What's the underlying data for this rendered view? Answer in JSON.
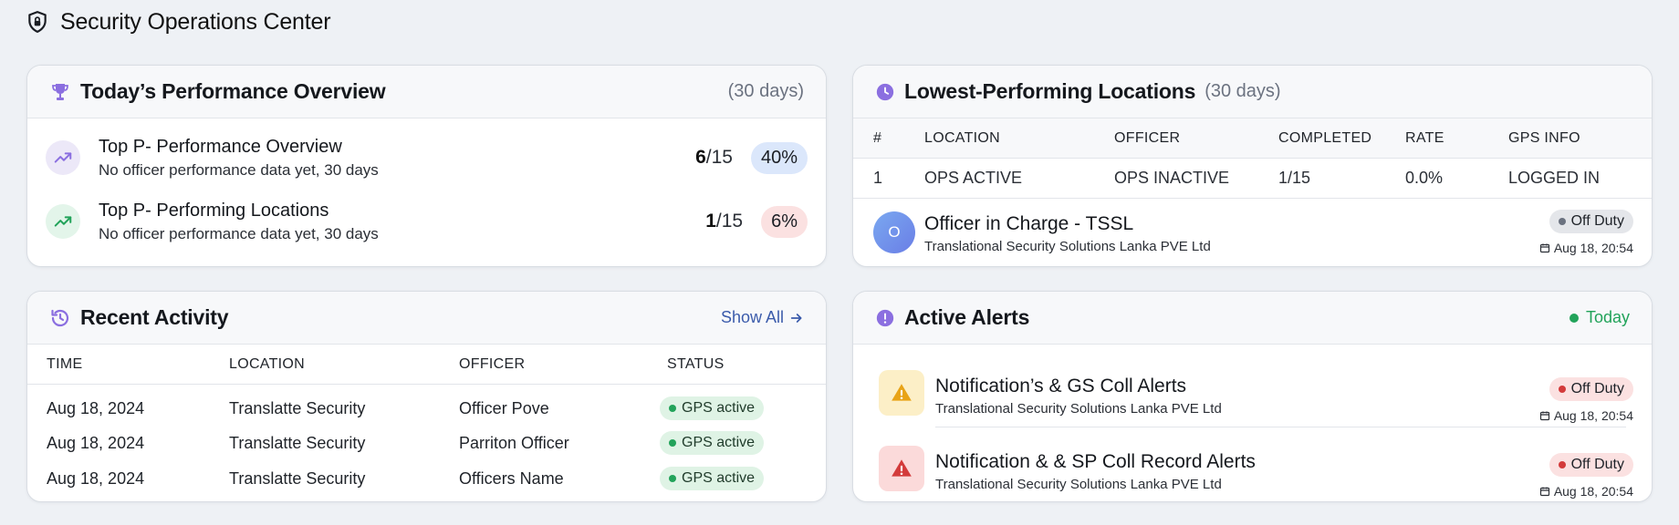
{
  "header": {
    "title": "Security Operations Center",
    "icon": "shield-lock-icon"
  },
  "performance": {
    "title": "Today’s Performance Overview",
    "period": "(30 days)",
    "rows": [
      {
        "title": "Top P- Performance Overview",
        "subtitle": "No officer performance data yet, 30 days",
        "count": "6",
        "total": "/15",
        "percent": "40%",
        "icon": "trend-up-icon",
        "pill_color": "#dbe7fb"
      },
      {
        "title": "Top P- Performing Locations",
        "subtitle": "No officer performance data yet, 30 days",
        "count": "1",
        "total": "/15",
        "percent": "6%",
        "icon": "trend-up-icon",
        "pill_color": "#fbe1e1"
      }
    ]
  },
  "lowest": {
    "title": "Lowest-Performing Locations",
    "period": "(30 days)",
    "columns": [
      "#",
      "LOCATION",
      "OFFICER",
      "COMPLETED",
      "RATE",
      "GPS INFO"
    ],
    "rows": [
      [
        "1",
        "OPS ACTIVE",
        "OPS INACTIVE",
        "1/15",
        "0.0%",
        "LOGGED IN"
      ]
    ],
    "officer": {
      "initial": "O",
      "name": "Officer in Charge - TSSL",
      "org": "Translational Security Solutions Lanka PVE Ltd",
      "status": "Off Duty",
      "time": "Aug 18, 20:54"
    }
  },
  "recent": {
    "title": "Recent Activity",
    "show_all": "Show All",
    "columns": [
      "TIME",
      "LOCATION",
      "OFFICER",
      "STATUS"
    ],
    "rows": [
      [
        "Aug 18, 2024",
        "Translatte Security",
        "Officer Pove",
        "GPS active"
      ],
      [
        "Aug 18, 2024",
        "Translatte Security",
        "Parriton Officer",
        "GPS active"
      ],
      [
        "Aug 18, 2024",
        "Translatte Security",
        "Officers Name",
        "GPS active"
      ]
    ]
  },
  "alerts": {
    "title": "Active Alerts",
    "today": "Today",
    "items": [
      {
        "title": "Notification’s & GS Coll Alerts",
        "org": "Translational Security Solutions Lanka PVE Ltd",
        "status": "Off Duty",
        "time": "Aug 18, 20:54",
        "icon": "warning-triangle-icon",
        "icon_color": "#e8a317"
      },
      {
        "title": "Notification & & SP Coll Record Alerts",
        "org": "Translational Security Solutions Lanka PVE Ltd",
        "status": "Off Duty",
        "time": "Aug 18, 20:54",
        "icon": "alert-triangle-icon",
        "icon_color": "#d33b3b"
      }
    ]
  },
  "colors": {
    "accent": "#8b6fe0",
    "green": "#22a35a",
    "link": "#3b5bab",
    "red": "#d33b3b"
  }
}
